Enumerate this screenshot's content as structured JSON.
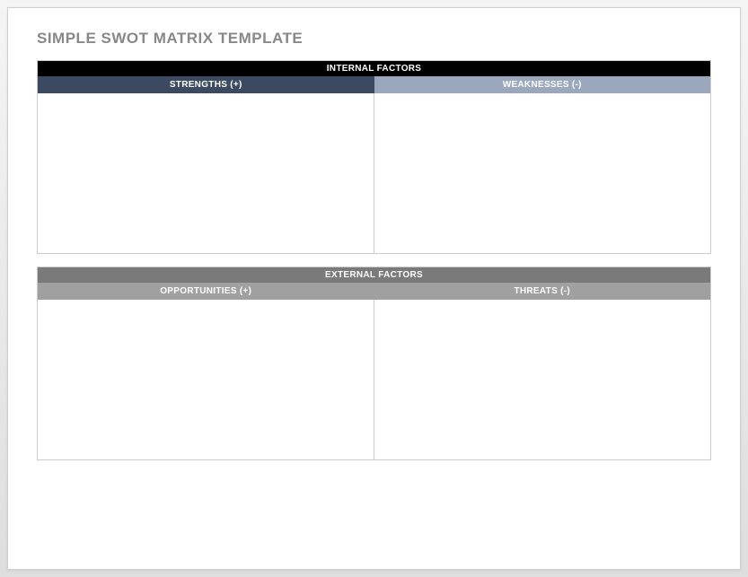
{
  "title": "SIMPLE SWOT MATRIX TEMPLATE",
  "sections": {
    "internal": {
      "header": "INTERNAL FACTORS",
      "left": {
        "header": "STRENGTHS (+)",
        "content": ""
      },
      "right": {
        "header": "WEAKNESSES (-)",
        "content": ""
      }
    },
    "external": {
      "header": "EXTERNAL FACTORS",
      "left": {
        "header": "OPPORTUNITIES (+)",
        "content": ""
      },
      "right": {
        "header": "THREATS (-)",
        "content": ""
      }
    }
  }
}
